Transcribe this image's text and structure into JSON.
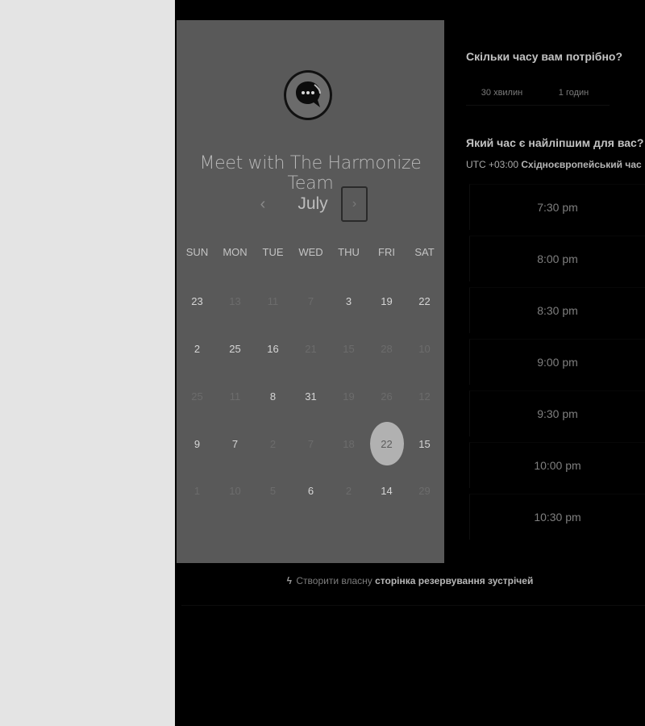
{
  "card": {
    "title": "Meet with The Harmonize Team",
    "month": "July",
    "prev_icon": "‹",
    "next_icon": "›",
    "weekdays": [
      "SUN",
      "MON",
      "TUE",
      "WED",
      "THU",
      "FRI",
      "SAT"
    ],
    "weeks": [
      [
        {
          "d": "23",
          "m": false
        },
        {
          "d": "13",
          "m": true
        },
        {
          "d": "11",
          "m": true
        },
        {
          "d": "7",
          "m": true
        },
        {
          "d": "3",
          "m": false
        },
        {
          "d": "19",
          "m": false
        },
        {
          "d": "22",
          "m": false
        }
      ],
      [
        {
          "d": "2",
          "m": false
        },
        {
          "d": "25",
          "m": false
        },
        {
          "d": "16",
          "m": false
        },
        {
          "d": "21",
          "m": true
        },
        {
          "d": "15",
          "m": true
        },
        {
          "d": "28",
          "m": true
        },
        {
          "d": "10",
          "m": true
        }
      ],
      [
        {
          "d": "25",
          "m": true
        },
        {
          "d": "11",
          "m": true
        },
        {
          "d": "8",
          "m": false
        },
        {
          "d": "31",
          "m": false
        },
        {
          "d": "19",
          "m": true
        },
        {
          "d": "26",
          "m": true
        },
        {
          "d": "12",
          "m": true
        }
      ],
      [
        {
          "d": "9",
          "m": false
        },
        {
          "d": "7",
          "m": false
        },
        {
          "d": "2",
          "m": true
        },
        {
          "d": "7",
          "m": true
        },
        {
          "d": "18",
          "m": true
        },
        {
          "d": "22",
          "m": false,
          "sel": true
        },
        {
          "d": "15",
          "m": false
        }
      ],
      [
        {
          "d": "1",
          "m": true
        },
        {
          "d": "10",
          "m": true
        },
        {
          "d": "5",
          "m": true
        },
        {
          "d": "6",
          "m": false
        },
        {
          "d": "2",
          "m": true
        },
        {
          "d": "14",
          "m": false
        },
        {
          "d": "29",
          "m": true
        }
      ]
    ]
  },
  "duration": {
    "question": "Скільки часу вам потрібно?",
    "options": [
      "30 хвилин",
      "1 годин"
    ]
  },
  "time": {
    "question": "Який час є найліпшим для вас?",
    "tz_offset": "UTC +03:00",
    "tz_name": "Східноєвропейський час",
    "slots": [
      "7:30 pm",
      "8:00 pm",
      "8:30 pm",
      "9:00 pm",
      "9:30 pm",
      "10:00 pm",
      "10:30 pm"
    ]
  },
  "footer": {
    "prefix": "Створити власну",
    "link": "сторінка резервування зустрічей"
  },
  "colors": {
    "card_bg": "#595959",
    "selected_day": "#b1b1b1"
  }
}
